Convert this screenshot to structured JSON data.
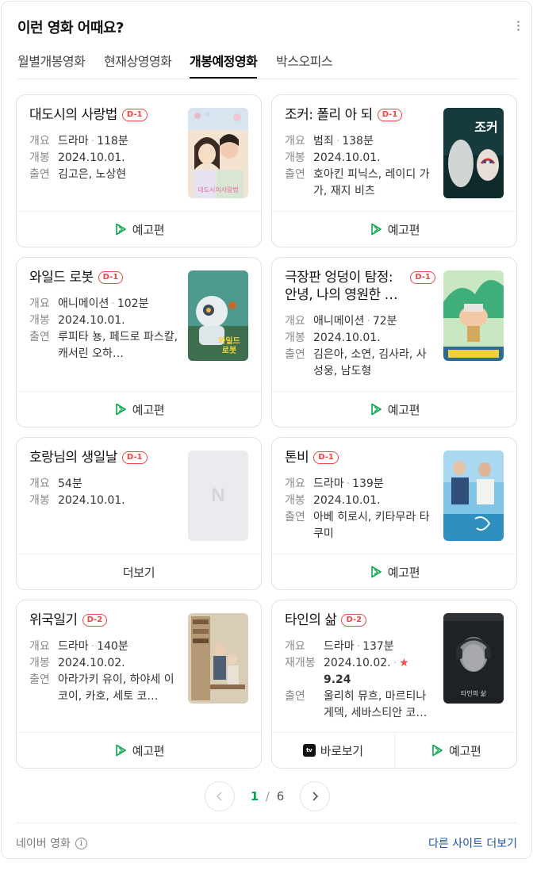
{
  "header": {
    "title": "이런 영화 어때요?"
  },
  "tabs": [
    {
      "label": "월별개봉영화"
    },
    {
      "label": "현재상영영화"
    },
    {
      "label": "개봉예정영화"
    },
    {
      "label": "박스오피스"
    }
  ],
  "active_tab": "개봉예정영화",
  "labels": {
    "genre": "개요",
    "release": "개봉",
    "rerelease": "재개봉",
    "cast": "출연",
    "trailer": "예고편",
    "more": "더보기",
    "watch": "바로보기",
    "sep": "·"
  },
  "movies": [
    {
      "title": "대도시의 사랑법",
      "badge": "D-1",
      "genre": "드라마",
      "runtime": "118분",
      "date": "2024.10.01.",
      "cast": "김고은, 노상현"
    },
    {
      "title": "조커: 폴리 아 되",
      "badge": "D-1",
      "genre": "범죄",
      "runtime": "138분",
      "date": "2024.10.01.",
      "cast": "호아킨 피닉스, 레이디 가가, 재지 비츠"
    },
    {
      "title": "와일드 로봇",
      "badge": "D-1",
      "genre": "애니메이션",
      "runtime": "102분",
      "date": "2024.10.01.",
      "cast": "루피타 뇽, 페드로 파스칼, 캐서린 오하…"
    },
    {
      "title": "극장판 엉덩이 탐정: 안녕, 나의 영원한 …",
      "badge": "D-1",
      "genre": "애니메이션",
      "runtime": "72분",
      "date": "2024.10.01.",
      "cast": "김은아, 소연, 김사라, 사성웅, 남도형"
    },
    {
      "title": "호랑님의 생일날",
      "badge": "D-1",
      "runtime": "54분",
      "date": "2024.10.01.",
      "placeholder_logo": "N"
    },
    {
      "title": "톤비",
      "badge": "D-1",
      "genre": "드라마",
      "runtime": "139분",
      "date": "2024.10.01.",
      "cast": "아베 히로시, 키타무라 타쿠미"
    },
    {
      "title": "위국일기",
      "badge": "D-2",
      "genre": "드라마",
      "runtime": "140분",
      "date": "2024.10.02.",
      "cast": "아라가키 유이, 하야세 이코이, 카호, 세토 코…"
    },
    {
      "title": "타인의 삶",
      "badge": "D-2",
      "genre": "드라마",
      "runtime": "137분",
      "date": "2024.10.02.",
      "rating": "9.24",
      "cast": "울리히 뮤흐, 마르티나 게덱, 세바스티안 코…"
    }
  ],
  "poster_text": {
    "m1": "대도시의사랑법",
    "m2": "조커",
    "m3a": "와일드",
    "m3b": "로봇",
    "m8": "타인의 삶"
  },
  "pagination": {
    "current": "1",
    "separator": "/",
    "total": "6"
  },
  "footer": {
    "source": "네이버 영화",
    "info_glyph": "i",
    "other_sites": "다른 사이트 더보기"
  },
  "colors": {
    "accent_green": "#0aa64f",
    "badge_red": "#ea4646",
    "link_blue": "#1a4fb5"
  },
  "icons": [
    "more-vertical-icon",
    "play-icon",
    "apple-tv-icon",
    "star-icon",
    "chevron-left-icon",
    "chevron-right-icon",
    "info-icon"
  ]
}
